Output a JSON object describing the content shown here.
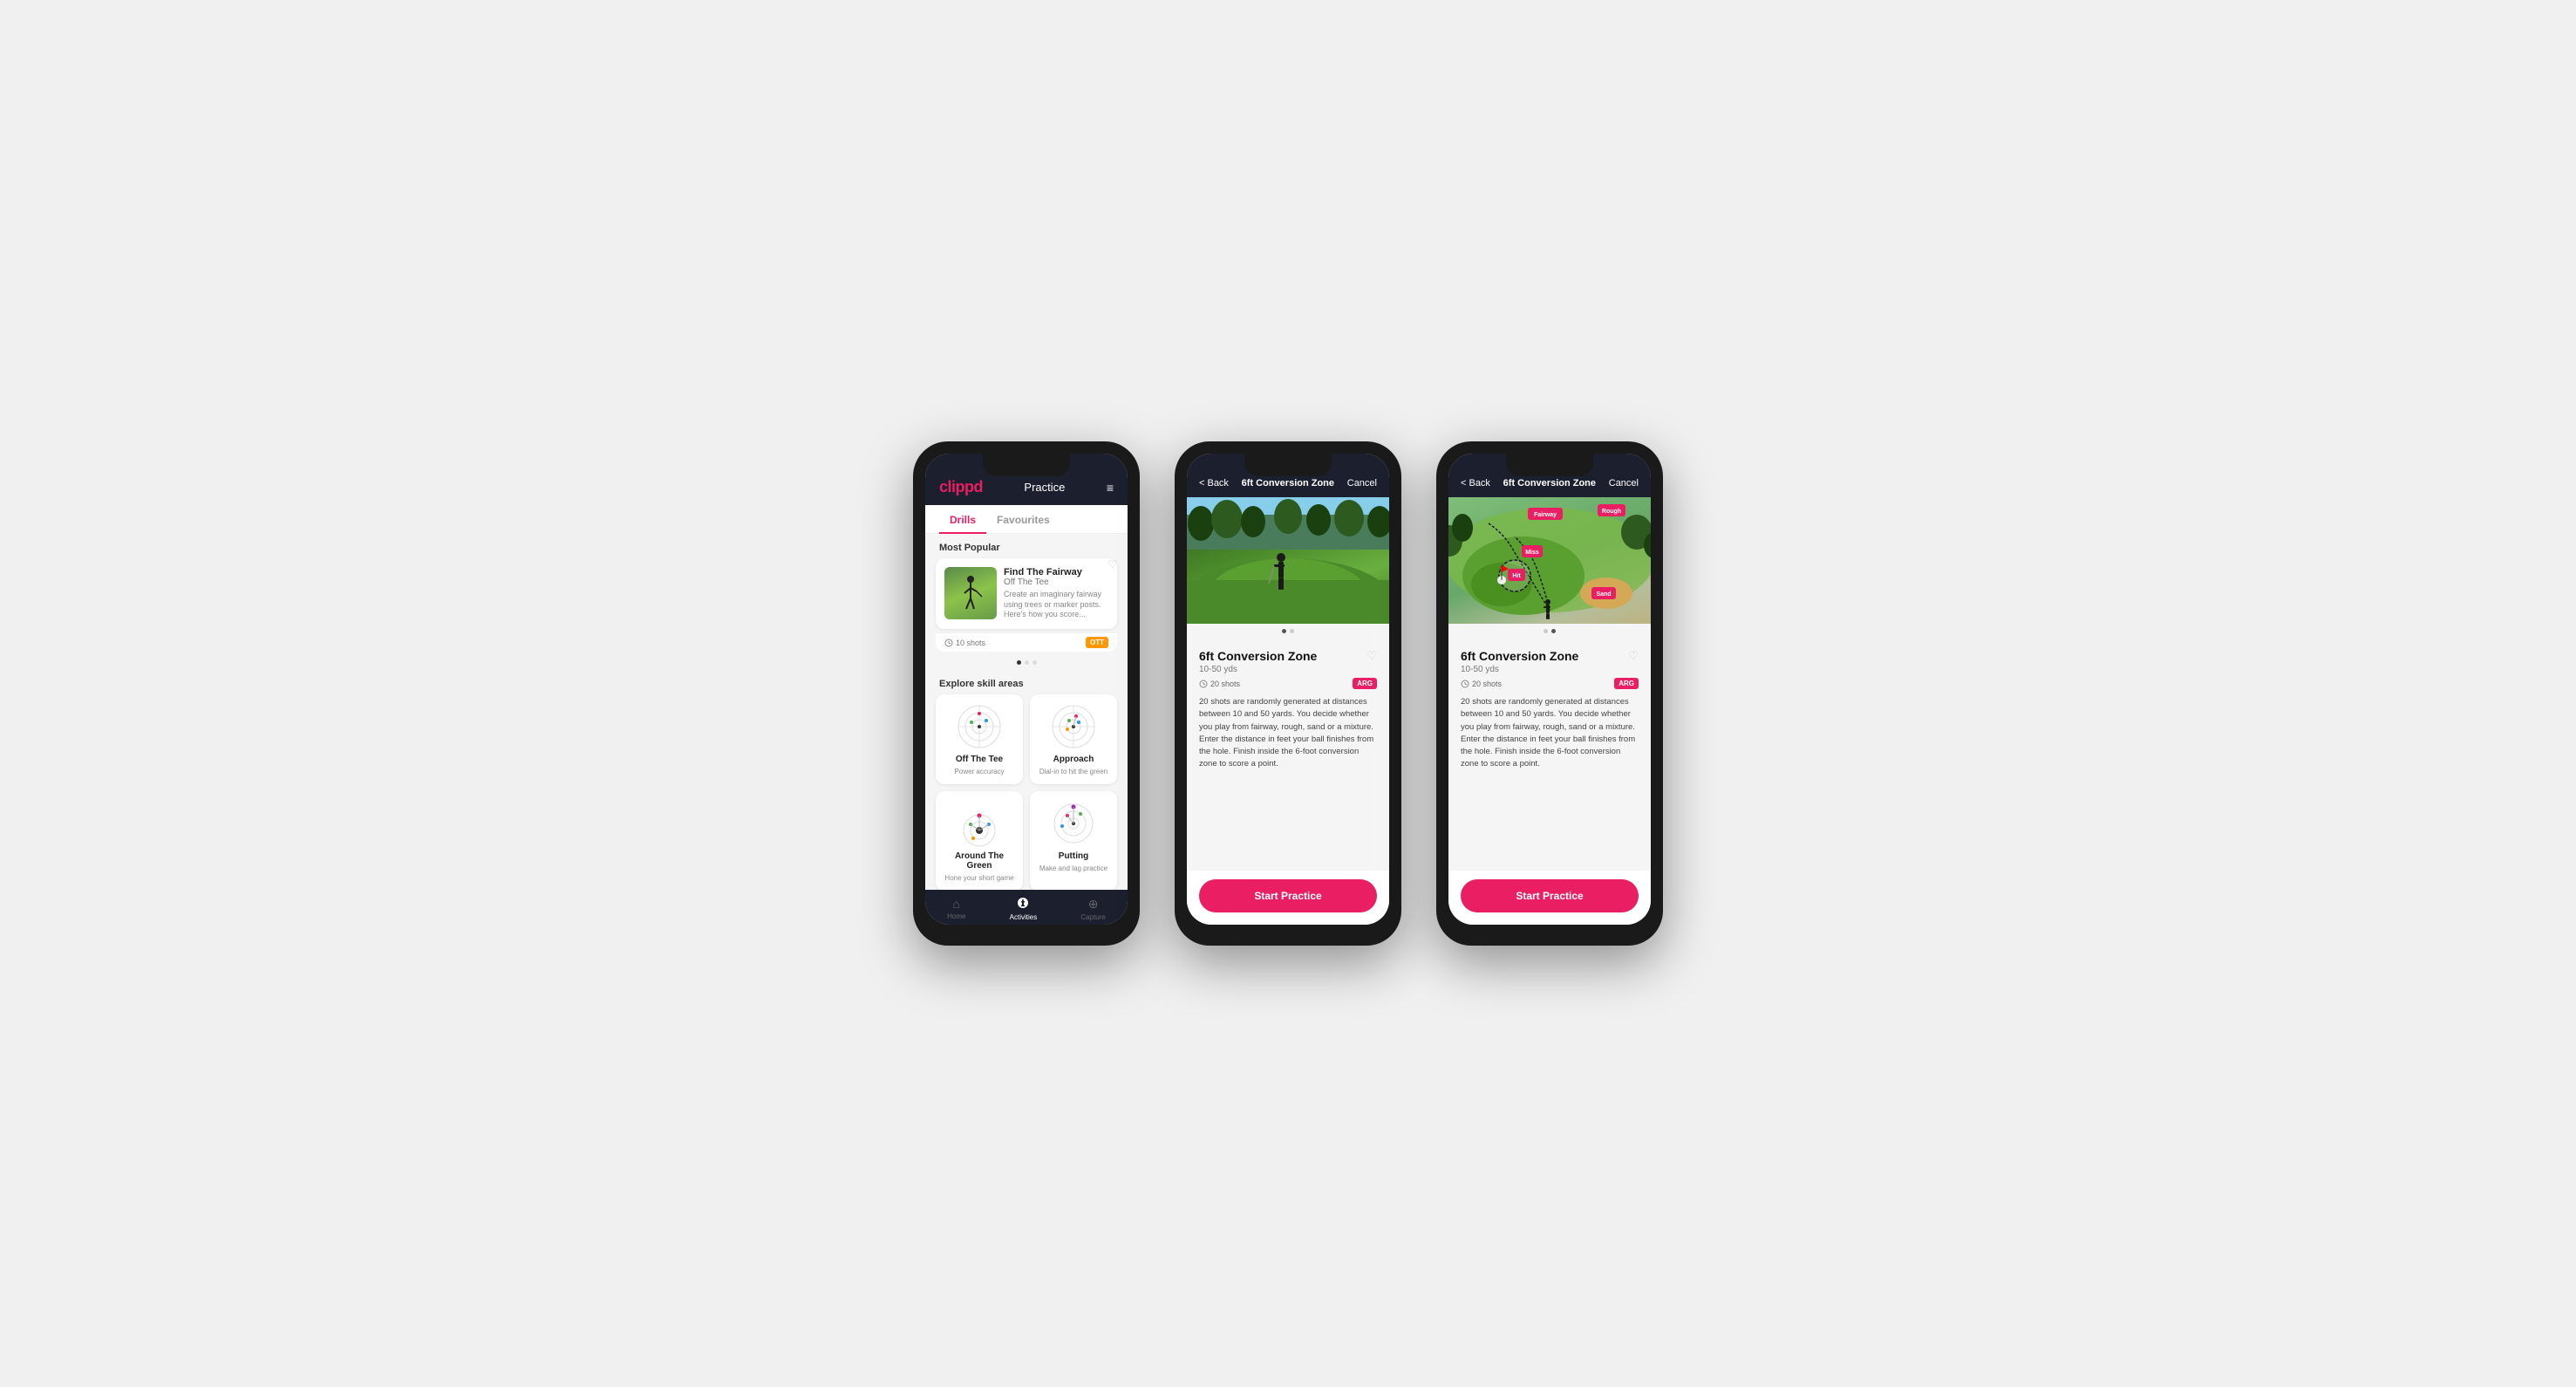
{
  "phone1": {
    "logo": "clippd",
    "header_title": "Practice",
    "menu_icon": "≡",
    "tabs": [
      {
        "label": "Drills",
        "active": true
      },
      {
        "label": "Favourites",
        "active": false
      }
    ],
    "most_popular_label": "Most Popular",
    "popular_card": {
      "title": "Find The Fairway",
      "subtitle": "Off The Tee",
      "description": "Create an imaginary fairway using trees or marker posts. Here's how you score...",
      "shots": "10 shots",
      "badge": "OTT"
    },
    "explore_label": "Explore skill areas",
    "skills": [
      {
        "name": "Off The Tee",
        "desc": "Power accuracy",
        "type": "ott"
      },
      {
        "name": "Approach",
        "desc": "Dial-in to hit the green",
        "type": "approach"
      },
      {
        "name": "Around The Green",
        "desc": "Hone your short game",
        "type": "atg"
      },
      {
        "name": "Putting",
        "desc": "Make and lag practice",
        "type": "putting"
      }
    ],
    "nav": [
      {
        "label": "Home",
        "icon": "⌂",
        "active": false
      },
      {
        "label": "Activities",
        "icon": "♣",
        "active": true
      },
      {
        "label": "Capture",
        "icon": "⊕",
        "active": false
      }
    ]
  },
  "phone2": {
    "back_label": "< Back",
    "header_title": "6ft Conversion Zone",
    "cancel_label": "Cancel",
    "drill_title": "6ft Conversion Zone",
    "drill_subtitle": "10-50 yds",
    "shots": "20 shots",
    "badge": "ARG",
    "description": "20 shots are randomly generated at distances between 10 and 50 yards. You decide whether you play from fairway, rough, sand or a mixture. Enter the distance in feet your ball finishes from the hole. Finish inside the 6-foot conversion zone to score a point.",
    "cta_label": "Start Practice",
    "image_type": "photo"
  },
  "phone3": {
    "back_label": "< Back",
    "header_title": "6ft Conversion Zone",
    "cancel_label": "Cancel",
    "drill_title": "6ft Conversion Zone",
    "drill_subtitle": "10-50 yds",
    "shots": "20 shots",
    "badge": "ARG",
    "description": "20 shots are randomly generated at distances between 10 and 50 yards. You decide whether you play from fairway, rough, sand or a mixture. Enter the distance in feet your ball finishes from the hole. Finish inside the 6-foot conversion zone to score a point.",
    "cta_label": "Start Practice",
    "image_type": "map",
    "map_labels": [
      "Fairway",
      "Rough",
      "Miss",
      "Hit",
      "Sand"
    ]
  }
}
